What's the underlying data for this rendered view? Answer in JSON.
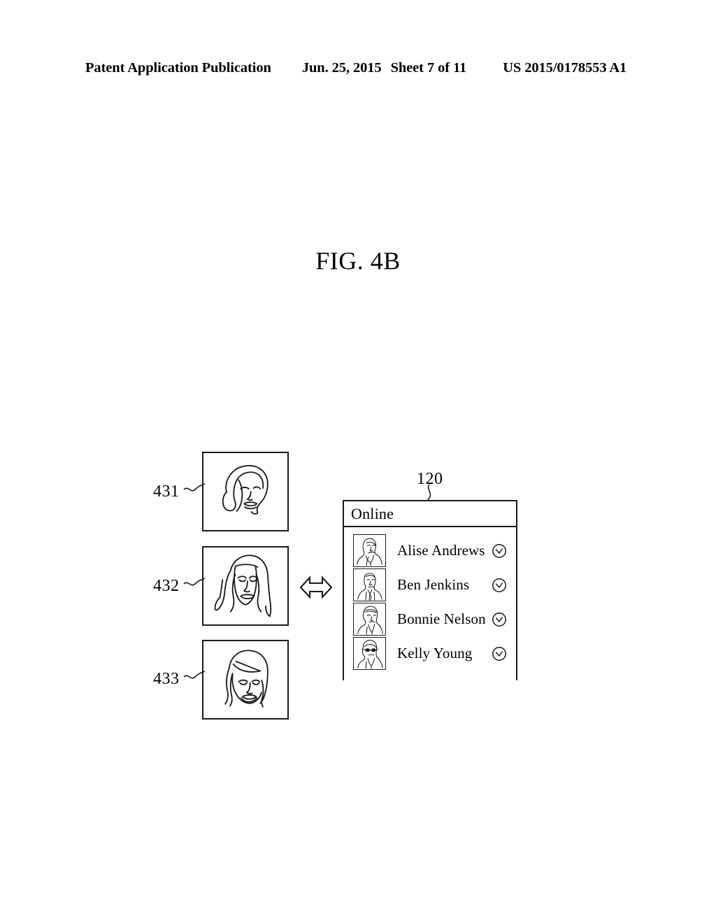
{
  "header": {
    "publication": "Patent Application Publication",
    "date": "Jun. 25, 2015",
    "sheet": "Sheet 7 of 11",
    "patent_number": "US 2015/0178553 A1"
  },
  "figure": {
    "title": "FIG. 4B"
  },
  "frames": [
    {
      "ref": "431",
      "icon": "tilted-face-line-art"
    },
    {
      "ref": "432",
      "icon": "frontal-face-long-hair-line-art"
    },
    {
      "ref": "433",
      "icon": "smiling-face-line-art"
    }
  ],
  "arrow": {
    "icon": "double-headed-horizontal-arrow"
  },
  "panel": {
    "ref": "120",
    "header_label": "Online",
    "contacts": [
      {
        "name": "Alise Andrews",
        "avatar": "woman-portrait-thumbnail",
        "action_icon": "chevron-down-circle-icon"
      },
      {
        "name": "Ben Jenkins",
        "avatar": "man-portrait-thumbnail",
        "action_icon": "chevron-down-circle-icon"
      },
      {
        "name": "Bonnie Nelson",
        "avatar": "person-portrait-thumbnail",
        "action_icon": "chevron-down-circle-icon"
      },
      {
        "name": "Kelly Young",
        "avatar": "woman-sunglasses-portrait-thumbnail",
        "action_icon": "chevron-down-circle-icon"
      }
    ]
  },
  "colors": {
    "ink": "#1a1a1a",
    "background": "#ffffff"
  }
}
